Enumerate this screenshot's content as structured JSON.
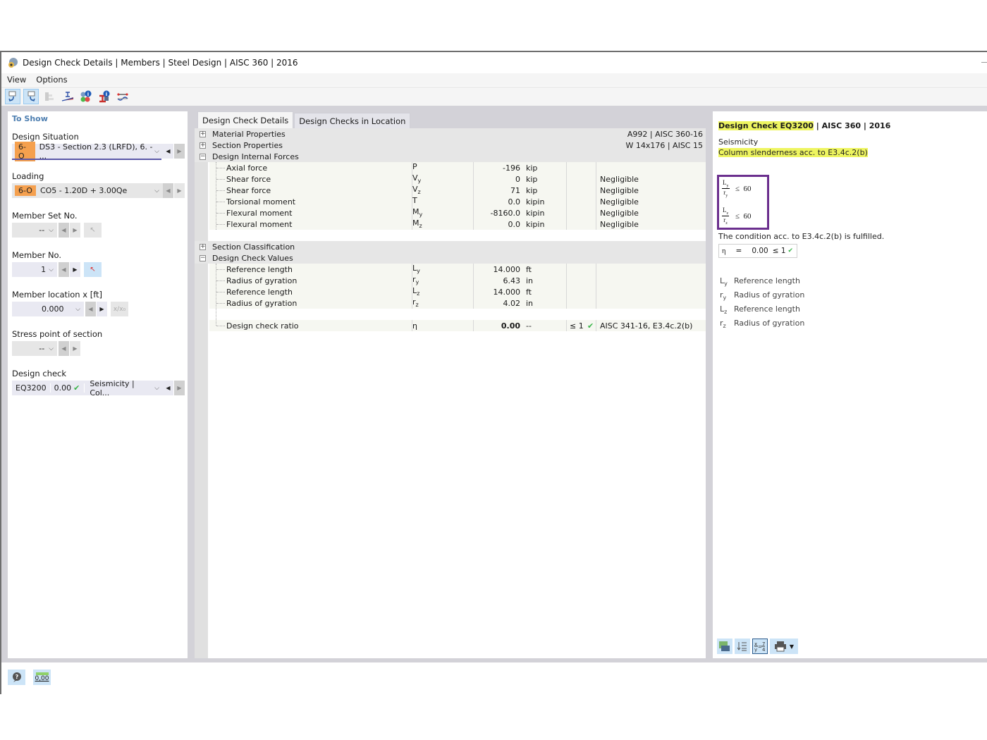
{
  "window": {
    "title": "Design Check Details | Members | Steel Design | AISC 360 | 2016",
    "icon": "app-icon"
  },
  "menu": [
    "View",
    "Options"
  ],
  "toolbar": {
    "buttons": [
      {
        "name": "previous-view-icon",
        "active": true
      },
      {
        "name": "next-view-icon",
        "active": true
      },
      {
        "name": "member-list-icon",
        "active": false
      },
      {
        "name": "section-diagram-icon",
        "active": false
      },
      {
        "name": "color-info-icon",
        "active": false
      },
      {
        "name": "member-info-icon",
        "active": false
      },
      {
        "name": "member-deformation-icon",
        "active": false
      }
    ]
  },
  "left": {
    "heading": "To Show",
    "design_situation": {
      "label": "Design Situation",
      "badge": "6-O",
      "value": "DS3 - Section 2.3 (LRFD), 6. - ..."
    },
    "loading": {
      "label": "Loading",
      "badge": "6-O",
      "value": "CO5 - 1.20D + 3.00Qe"
    },
    "member_set": {
      "label": "Member Set No.",
      "value": "--"
    },
    "member_no": {
      "label": "Member No.",
      "value": "1"
    },
    "member_location": {
      "label": "Member location x [ft]",
      "value": "0.000",
      "relative_label": "x/x₀"
    },
    "stress_point": {
      "label": "Stress point of section",
      "value": "--"
    },
    "design_check": {
      "label": "Design check",
      "id": "EQ3200",
      "ratio": "0.00",
      "type": "Seismicity | Col..."
    }
  },
  "center": {
    "tabs": [
      {
        "label": "Design Check Details",
        "active": true
      },
      {
        "label": "Design Checks in Location",
        "active": false
      }
    ],
    "groups": {
      "material": {
        "label": "Material Properties",
        "value": "A992 | AISC 360-16",
        "expanded": false
      },
      "section": {
        "label": "Section Properties",
        "value": "W 14x176 | AISC 15",
        "expanded": false
      },
      "forces": {
        "label": "Design Internal Forces",
        "value": "",
        "expanded": true
      },
      "classification": {
        "label": "Section Classification",
        "value": "",
        "expanded": false
      },
      "values": {
        "label": "Design Check Values",
        "value": "",
        "expanded": true
      }
    },
    "forces_rows": [
      {
        "label": "Axial force",
        "symbol": "P",
        "value": "-196",
        "unit": "kip",
        "note": ""
      },
      {
        "label": "Shear force",
        "symbol": "Vy",
        "value": "0",
        "unit": "kip",
        "note": "Negligible"
      },
      {
        "label": "Shear force",
        "symbol": "Vz",
        "value": "71",
        "unit": "kip",
        "note": "Negligible"
      },
      {
        "label": "Torsional moment",
        "symbol": "T",
        "value": "0.0",
        "unit": "kipin",
        "note": "Negligible"
      },
      {
        "label": "Flexural moment",
        "symbol": "My",
        "value": "-8160.0",
        "unit": "kipin",
        "note": "Negligible"
      },
      {
        "label": "Flexural moment",
        "symbol": "Mz",
        "value": "0.0",
        "unit": "kipin",
        "note": "Negligible"
      }
    ],
    "values_rows": [
      {
        "label": "Reference length",
        "symbol": "Ly",
        "value": "14.000",
        "unit": "ft"
      },
      {
        "label": "Radius of gyration",
        "symbol": "ry",
        "value": "6.43",
        "unit": "in"
      },
      {
        "label": "Reference length",
        "symbol": "Lz",
        "value": "14.000",
        "unit": "ft"
      },
      {
        "label": "Radius of gyration",
        "symbol": "rz",
        "value": "4.02",
        "unit": "in"
      }
    ],
    "ratio_row": {
      "label": "Design check ratio",
      "symbol": "η",
      "value": "0.00",
      "unit": "--",
      "compare": "≤ 1",
      "reference": "AISC 341-16, E3.4c.2(b)"
    }
  },
  "right": {
    "title_highlight": "Design Check EQ3200",
    "title_rest": " | AISC 360 | 2016",
    "category": "Seismicity",
    "description": "Column slenderness acc. to E3.4c.2(b)",
    "formulas": [
      {
        "num": "L",
        "num_sub": "y",
        "den": "r",
        "den_sub": "y",
        "op": "≤",
        "limit": "60"
      },
      {
        "num": "L",
        "num_sub": "z",
        "den": "r",
        "den_sub": "z",
        "op": "≤",
        "limit": "60"
      }
    ],
    "conclusion": "The condition acc. to E3.4c.2(b) is fulfilled.",
    "eta": {
      "symbol": "η",
      "eq": "=",
      "value": "0.00",
      "compare": "≤ 1"
    },
    "legend": [
      {
        "sym": "L",
        "sub": "y",
        "text": "Reference length"
      },
      {
        "sym": "r",
        "sub": "y",
        "text": "Radius of gyration"
      },
      {
        "sym": "L",
        "sub": "z",
        "text": "Reference length"
      },
      {
        "sym": "r",
        "sub": "z",
        "text": "Radius of gyration"
      }
    ],
    "toolbar": [
      "export-image-icon",
      "numbering-icon",
      "formula-icon",
      "print-icon"
    ]
  },
  "status": {
    "decimals_label": "0,00"
  },
  "colors": {
    "badge": "#f5a04e",
    "highlight": "#eef560",
    "formula_border": "#6b2f8e",
    "check_green": "#3bb54a",
    "heading_blue": "#4d7eb0"
  }
}
